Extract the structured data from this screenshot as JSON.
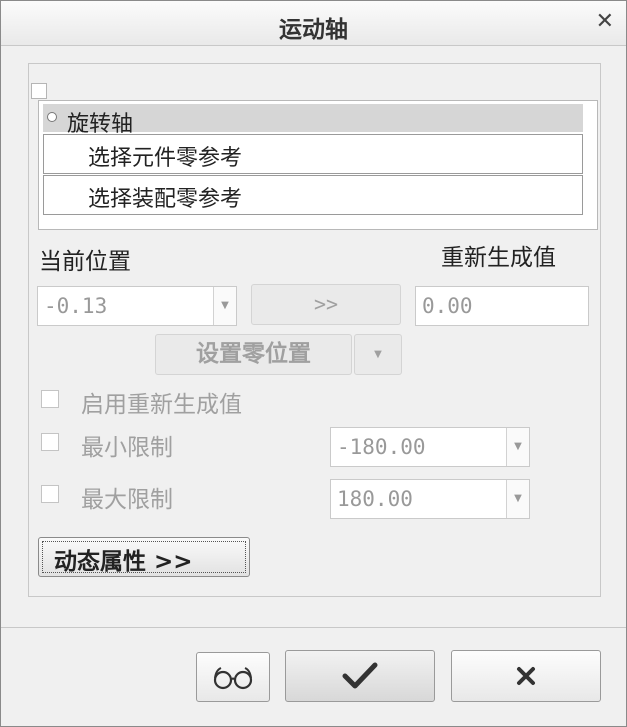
{
  "dialog": {
    "title": "运动轴",
    "close_icon": "close-icon"
  },
  "axis": {
    "title": "旋转轴",
    "ref1": "选择元件零参考",
    "ref2": "选择装配零参考"
  },
  "position": {
    "current_label": "当前位置",
    "regen_label": "重新生成值",
    "current_value": "-0.13",
    "transfer_button": ">>",
    "regen_value": "0.00",
    "set_zero_button": "设置零位置"
  },
  "options": {
    "enable_regen": {
      "label": "启用重新生成值",
      "checked": false
    },
    "min_limit": {
      "label": "最小限制",
      "checked": false,
      "value": "-180.00"
    },
    "max_limit": {
      "label": "最大限制",
      "checked": false,
      "value": "180.00"
    }
  },
  "dynamic_properties_button": "动态属性 >>",
  "footer": {
    "preview_icon": "glasses-icon",
    "ok_icon": "checkmark-icon",
    "cancel_icon": "close-icon"
  }
}
